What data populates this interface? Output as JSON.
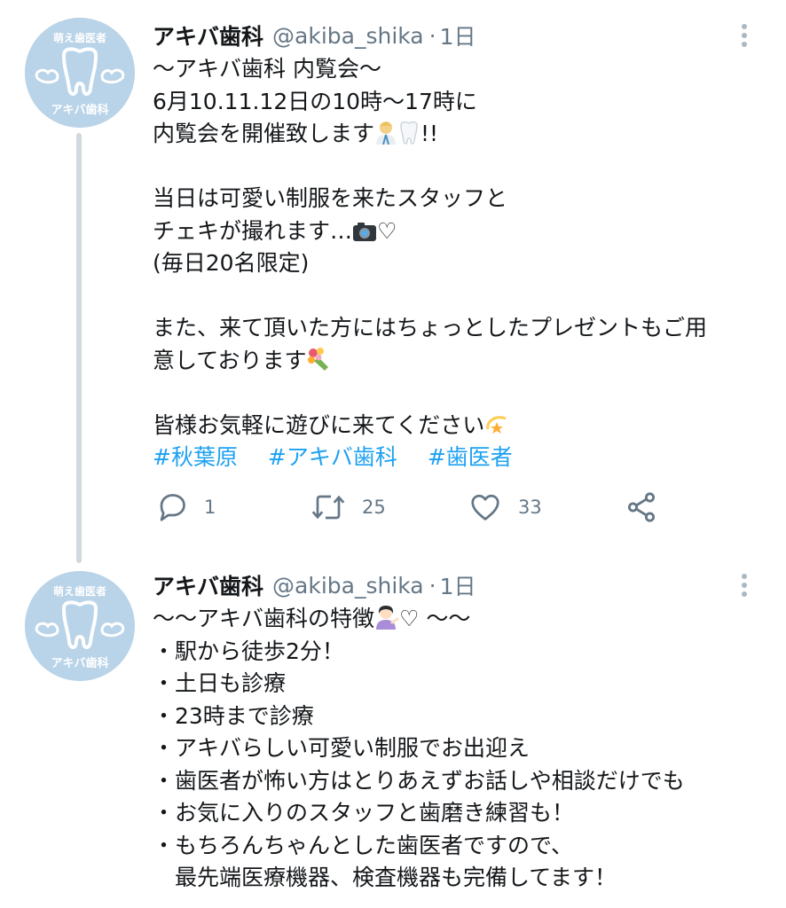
{
  "tweets": [
    {
      "name": "アキバ歯科",
      "handle": "@akiba_shika",
      "separator": "·",
      "time": "1日",
      "avatar": {
        "top_text": "萌え歯医者",
        "bottom_text": "アキバ歯科"
      },
      "lines": [
        "〜アキバ歯科 内覧会〜",
        "6月10.11.12日の10時〜17時に",
        "内覧会を開催致します",
        "",
        "当日は可愛い制服を来たスタッフと",
        "チェキが撮れます…",
        "(毎日20名限定)",
        "",
        "また、来て頂いた方にはちょっとしたプレゼントもご用",
        "意しております",
        "",
        "皆様お気軽に遊びに来てください"
      ],
      "line_suffix": {
        "l2": "!!",
        "l5": "♡"
      },
      "hashtags": [
        "#秋葉原",
        "#アキバ歯科",
        "#歯医者"
      ],
      "actions": {
        "reply": "1",
        "retweet": "25",
        "like": "33"
      }
    },
    {
      "name": "アキバ歯科",
      "handle": "@akiba_shika",
      "separator": "·",
      "time": "1日",
      "avatar": {
        "top_text": "萌え歯医者",
        "bottom_text": "アキバ歯科"
      },
      "title_prefix": "〜〜アキバ歯科の特徴",
      "title_suffix": "♡ 〜〜",
      "lines": [
        "・駅から徒歩2分！",
        "・土日も診療",
        "・23時まで診療",
        "・アキバらしい可愛い制服でお出迎え",
        "・歯医者が怖い方はとりあえずお話しや相談だけでも",
        "・お気に入りのスタッフと歯磨き練習も！",
        "・もちろんちゃんとした歯医者ですので、",
        "　最先端医療機器、検査機器も完備してます！"
      ]
    }
  ],
  "colors": {
    "link": "#1da1f2",
    "avatar_bg": "#b9d3e8",
    "muted": "#657786"
  },
  "icons": [
    "reply-icon",
    "retweet-icon",
    "like-icon",
    "share-icon",
    "more-icon",
    "tooth-logo"
  ]
}
